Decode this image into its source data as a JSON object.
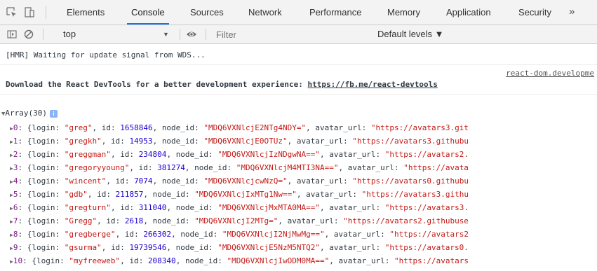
{
  "tabs": [
    {
      "label": "Elements",
      "active": false
    },
    {
      "label": "Console",
      "active": true
    },
    {
      "label": "Sources",
      "active": false
    },
    {
      "label": "Network",
      "active": false
    },
    {
      "label": "Performance",
      "active": false
    },
    {
      "label": "Memory",
      "active": false
    },
    {
      "label": "Application",
      "active": false
    },
    {
      "label": "Security",
      "active": false
    }
  ],
  "more_tabs_glyph": "»",
  "toolbar": {
    "context": "top",
    "context_caret": "▼",
    "filter_placeholder": "Filter",
    "levels_label": "Default levels ▼"
  },
  "console": {
    "hmr_message": "[HMR] Waiting for update signal from WDS...",
    "source_link": "react-dom.developme",
    "devtools_message": "Download the React DevTools for a better development experience: ",
    "devtools_url": "https://fb.me/react-devtools",
    "array_label": "Array(30)",
    "info_badge": "i",
    "rows": [
      {
        "index": "0",
        "login": "greg",
        "id": "1658846",
        "node_id": "MDQ6VXNlcjE2NTg4NDY=",
        "avatar_url": "https://avatars3.git"
      },
      {
        "index": "1",
        "login": "gregkh",
        "id": "14953",
        "node_id": "MDQ6VXNlcjE0OTUz",
        "avatar_url": "https://avatars3.githubu"
      },
      {
        "index": "2",
        "login": "greggman",
        "id": "234804",
        "node_id": "MDQ6VXNlcjIzNDgwNA==",
        "avatar_url": "https://avatars2."
      },
      {
        "index": "3",
        "login": "gregoryyoung",
        "id": "381274",
        "node_id": "MDQ6VXNlcjM4MTI3NA==",
        "avatar_url": "https://avata"
      },
      {
        "index": "4",
        "login": "wincent",
        "id": "7074",
        "node_id": "MDQ6VXNlcjcwNzQ=",
        "avatar_url": "https://avatars0.githubu"
      },
      {
        "index": "5",
        "login": "gdb",
        "id": "211857",
        "node_id": "MDQ6VXNlcjIxMTg1Nw==",
        "avatar_url": "https://avatars3.githu"
      },
      {
        "index": "6",
        "login": "gregturn",
        "id": "311040",
        "node_id": "MDQ6VXNlcjMxMTA0MA==",
        "avatar_url": "https://avatars3."
      },
      {
        "index": "7",
        "login": "Gregg",
        "id": "2618",
        "node_id": "MDQ6VXNlcjI2MTg=",
        "avatar_url": "https://avatars2.githubuse"
      },
      {
        "index": "8",
        "login": "gregberge",
        "id": "266302",
        "node_id": "MDQ6VXNlcjI2NjMwMg==",
        "avatar_url": "https://avatars2"
      },
      {
        "index": "9",
        "login": "gsurma",
        "id": "19739546",
        "node_id": "MDQ6VXNlcjE5NzM5NTQ2",
        "avatar_url": "https://avatars0."
      },
      {
        "index": "10",
        "login": "myfreeweb",
        "id": "208340",
        "node_id": "MDQ6VXNlcjIwODM0MA==",
        "avatar_url": "https://avatars"
      }
    ]
  }
}
